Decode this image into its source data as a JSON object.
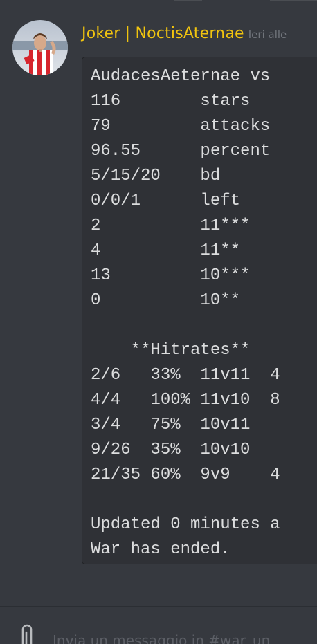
{
  "message": {
    "username": "Joker | NoctisAternae",
    "timestamp": "Ieri alle",
    "lines": [
      "AudacesAeternae vs",
      "116        stars",
      "79         attacks",
      "96.55      percent",
      "5/15/20    bd",
      "0/0/1      left",
      "2          11***",
      "4          11**",
      "13         10***",
      "0          10**",
      "",
      "    **Hitrates**",
      "2/6   33%  11v11  4",
      "4/4   100% 11v10  8",
      "3/4   75%  10v11",
      "9/26  35%  10v10",
      "21/35 60%  9v9    4",
      "",
      "Updated 0 minutes a",
      "War has ended."
    ]
  },
  "composer": {
    "placeholder": "Invia un messaggio in #war_un"
  },
  "icons": {
    "attach": "paperclip-icon",
    "avatar": "user-avatar"
  },
  "colors": {
    "background": "#36393f",
    "codeblock_bg": "#2f3136",
    "username": "#f1c40f",
    "timestamp": "#72767d",
    "code_text": "#dcddde"
  }
}
